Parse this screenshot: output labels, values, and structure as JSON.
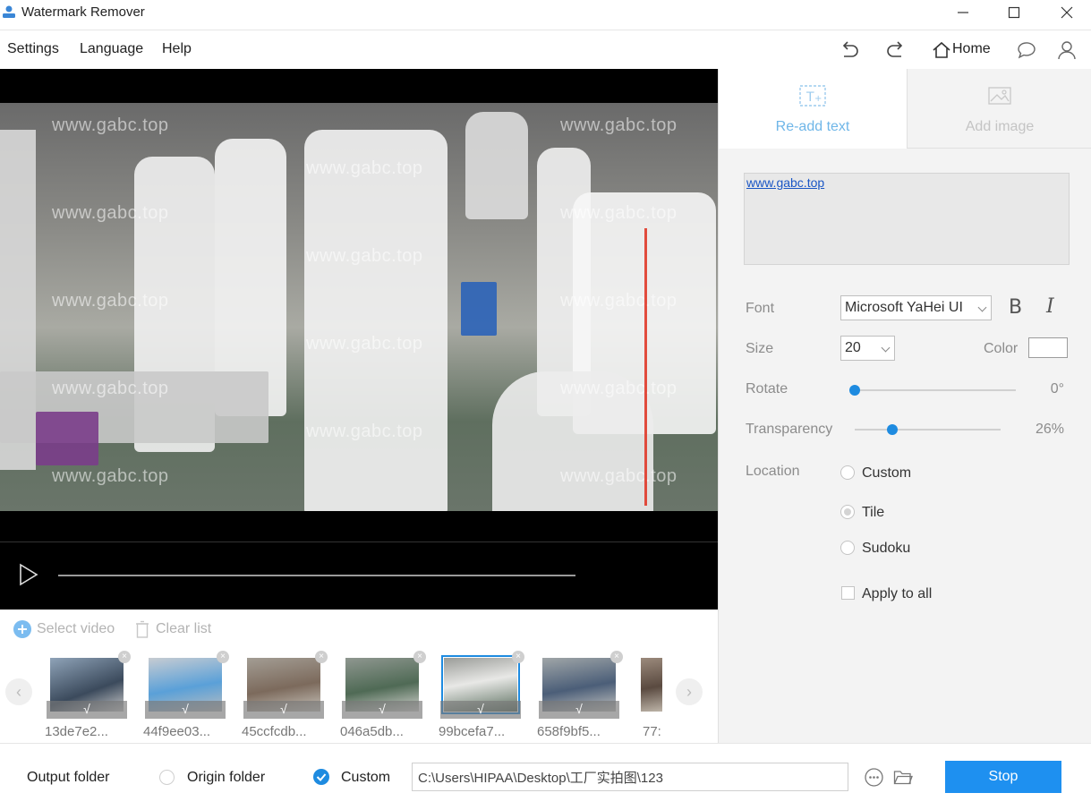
{
  "window": {
    "title": "Watermark Remover"
  },
  "menu": {
    "items": [
      "Settings",
      "Language",
      "Help"
    ],
    "home_label": "Home"
  },
  "video": {
    "watermark_text": "www.gabc.top"
  },
  "list_toolbar": {
    "select_video": "Select video",
    "clear_list": "Clear list"
  },
  "thumbnails": [
    {
      "name": "13de7e2...",
      "check": "√",
      "selected": false
    },
    {
      "name": "44f9ee03...",
      "check": "√",
      "selected": false
    },
    {
      "name": "45ccfcdb...",
      "check": "√",
      "selected": false
    },
    {
      "name": "046a5db...",
      "check": "√",
      "selected": false
    },
    {
      "name": "99bcefa7...",
      "check": "√",
      "selected": true
    },
    {
      "name": "658f9bf5...",
      "check": "√",
      "selected": false
    },
    {
      "name": "77:",
      "check": "",
      "selected": false
    }
  ],
  "right_panel": {
    "tabs": {
      "readd_text": "Re-add text",
      "add_image": "Add image"
    },
    "text_content": "www.gabc.top",
    "font": {
      "label": "Font",
      "value": "Microsoft YaHei UI",
      "bold": "B",
      "italic": "I"
    },
    "size": {
      "label": "Size",
      "value": "20"
    },
    "color": {
      "label": "Color",
      "value": "#ffffff"
    },
    "rotate": {
      "label": "Rotate",
      "value": "0°",
      "level": 0
    },
    "transparency": {
      "label": "Transparency",
      "value": "26%",
      "level": 0.26
    },
    "location": {
      "label": "Location",
      "options": [
        "Custom",
        "Tile",
        "Sudoku"
      ],
      "selected": "Tile"
    },
    "apply_all": "Apply to all"
  },
  "bottom": {
    "output_folder": "Output folder",
    "origin_folder": "Origin folder",
    "custom": "Custom",
    "path": "C:\\Users\\HIPAA\\Desktop\\工厂实拍图\\123",
    "stop": "Stop"
  },
  "colors": {
    "accent": "#1e8be0",
    "tab_active": "#6fb6e8",
    "tab_inactive": "#c4c4c4"
  }
}
